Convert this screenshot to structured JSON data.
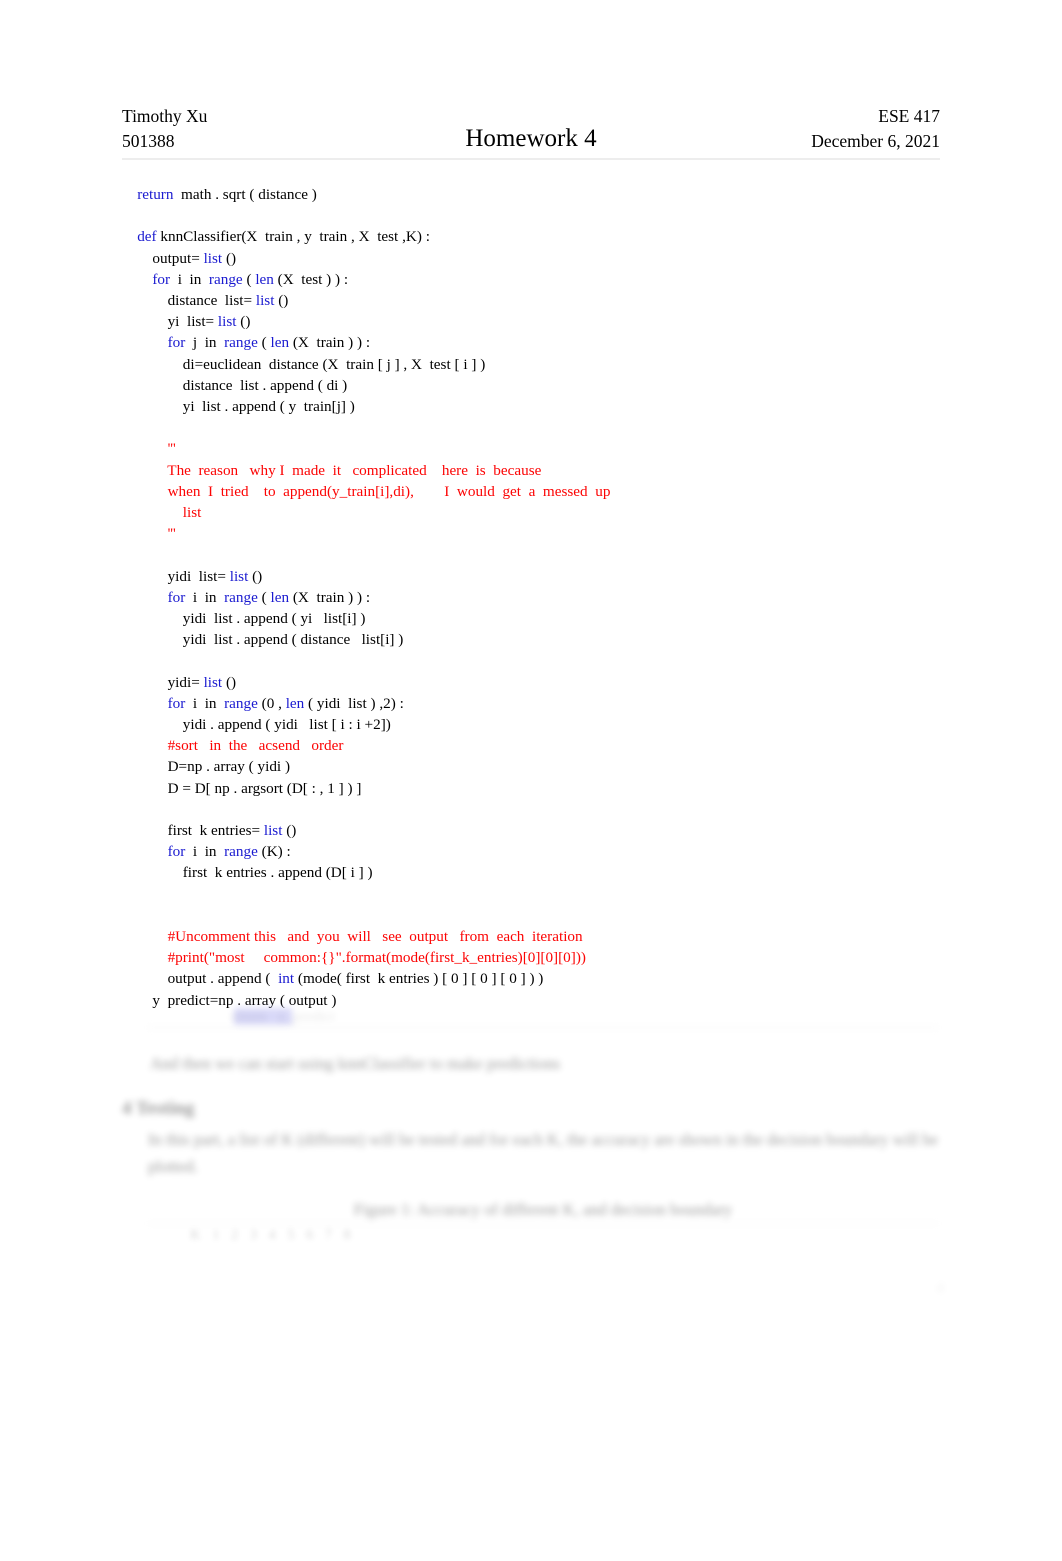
{
  "header": {
    "author": "Timothy Xu",
    "student_id": "501388",
    "title": "Homework  4",
    "course": "ESE 417",
    "date": "December 6, 2021"
  },
  "code": {
    "language": "python",
    "colors": {
      "keyword": "#1a1ad0",
      "comment": "#fc0404",
      "text": "#000000"
    },
    "lines": [
      {
        "indent": 1,
        "segments": [
          {
            "t": "kw",
            "v": "return"
          },
          {
            "t": "plain",
            "v": "  math . sqrt ( distance )"
          }
        ]
      },
      {
        "indent": 0,
        "segments": []
      },
      {
        "indent": 1,
        "segments": [
          {
            "t": "kw",
            "v": "def"
          },
          {
            "t": "plain",
            "v": " knnClassifier(X  train , y  train , X  test ,K) :"
          }
        ]
      },
      {
        "indent": 2,
        "segments": [
          {
            "t": "plain",
            "v": "output= "
          },
          {
            "t": "kw",
            "v": "list"
          },
          {
            "t": "plain",
            "v": " ()"
          }
        ]
      },
      {
        "indent": 2,
        "segments": [
          {
            "t": "kw",
            "v": "for"
          },
          {
            "t": "plain",
            "v": "  i  in  "
          },
          {
            "t": "kw",
            "v": "range"
          },
          {
            "t": "plain",
            "v": " ( "
          },
          {
            "t": "kw",
            "v": "len"
          },
          {
            "t": "plain",
            "v": " (X  test ) ) :"
          }
        ]
      },
      {
        "indent": 3,
        "segments": [
          {
            "t": "plain",
            "v": "distance  list= "
          },
          {
            "t": "kw",
            "v": "list"
          },
          {
            "t": "plain",
            "v": " ()"
          }
        ]
      },
      {
        "indent": 3,
        "segments": [
          {
            "t": "plain",
            "v": "yi  list= "
          },
          {
            "t": "kw",
            "v": "list"
          },
          {
            "t": "plain",
            "v": " ()"
          }
        ]
      },
      {
        "indent": 3,
        "segments": [
          {
            "t": "kw",
            "v": "for"
          },
          {
            "t": "plain",
            "v": "  j  in  "
          },
          {
            "t": "kw",
            "v": "range"
          },
          {
            "t": "plain",
            "v": " ( "
          },
          {
            "t": "kw",
            "v": "len"
          },
          {
            "t": "plain",
            "v": " (X  train ) ) :"
          }
        ]
      },
      {
        "indent": 4,
        "segments": [
          {
            "t": "plain",
            "v": "di=euclidean  distance (X  train [ j ] , X  test [ i ] )"
          }
        ]
      },
      {
        "indent": 4,
        "segments": [
          {
            "t": "plain",
            "v": "distance  list . append ( di )"
          }
        ]
      },
      {
        "indent": 4,
        "segments": [
          {
            "t": "plain",
            "v": "yi  list . append ( y  train[j] )"
          }
        ]
      },
      {
        "indent": 0,
        "segments": []
      },
      {
        "indent": 3,
        "segments": [
          {
            "t": "cm",
            "v": "'''"
          }
        ]
      },
      {
        "indent": 3,
        "segments": [
          {
            "t": "cm",
            "v": "The  reason   why I  made  it   complicated    here  is  because"
          }
        ]
      },
      {
        "indent": 3,
        "segments": [
          {
            "t": "cm",
            "v": "when  I  tried    to  append(y_train[i],di),        I  would  get  a  messed  up"
          }
        ]
      },
      {
        "indent": 4,
        "segments": [
          {
            "t": "cm",
            "v": "list"
          }
        ]
      },
      {
        "indent": 3,
        "segments": [
          {
            "t": "cm",
            "v": "'''"
          }
        ]
      },
      {
        "indent": 0,
        "segments": []
      },
      {
        "indent": 3,
        "segments": [
          {
            "t": "plain",
            "v": "yidi  list= "
          },
          {
            "t": "kw",
            "v": "list"
          },
          {
            "t": "plain",
            "v": " ()"
          }
        ]
      },
      {
        "indent": 3,
        "segments": [
          {
            "t": "kw",
            "v": "for"
          },
          {
            "t": "plain",
            "v": "  i  in  "
          },
          {
            "t": "kw",
            "v": "range"
          },
          {
            "t": "plain",
            "v": " ( "
          },
          {
            "t": "kw",
            "v": "len"
          },
          {
            "t": "plain",
            "v": " (X  train ) ) :"
          }
        ]
      },
      {
        "indent": 4,
        "segments": [
          {
            "t": "plain",
            "v": "yidi  list . append ( yi   list[i] )"
          }
        ]
      },
      {
        "indent": 4,
        "segments": [
          {
            "t": "plain",
            "v": "yidi  list . append ( distance   list[i] )"
          }
        ]
      },
      {
        "indent": 0,
        "segments": []
      },
      {
        "indent": 3,
        "segments": [
          {
            "t": "plain",
            "v": "yidi= "
          },
          {
            "t": "kw",
            "v": "list"
          },
          {
            "t": "plain",
            "v": " ()"
          }
        ]
      },
      {
        "indent": 3,
        "segments": [
          {
            "t": "kw",
            "v": "for"
          },
          {
            "t": "plain",
            "v": "  i  in  "
          },
          {
            "t": "kw",
            "v": "range"
          },
          {
            "t": "plain",
            "v": " (0 , "
          },
          {
            "t": "kw",
            "v": "len"
          },
          {
            "t": "plain",
            "v": " ( yidi  list ) ,2) :"
          }
        ]
      },
      {
        "indent": 4,
        "segments": [
          {
            "t": "plain",
            "v": "yidi . append ( yidi   list [ i : i +2])"
          }
        ]
      },
      {
        "indent": 3,
        "segments": [
          {
            "t": "cm",
            "v": "#sort   in  the   acsend   order"
          }
        ]
      },
      {
        "indent": 3,
        "segments": [
          {
            "t": "plain",
            "v": "D=np . array ( yidi )"
          }
        ]
      },
      {
        "indent": 3,
        "segments": [
          {
            "t": "plain",
            "v": "D = D[ np . argsort (D[ : , 1 ] ) ]"
          }
        ]
      },
      {
        "indent": 0,
        "segments": []
      },
      {
        "indent": 3,
        "segments": [
          {
            "t": "plain",
            "v": "first  k entries= "
          },
          {
            "t": "kw",
            "v": "list"
          },
          {
            "t": "plain",
            "v": " ()"
          }
        ]
      },
      {
        "indent": 3,
        "segments": [
          {
            "t": "kw",
            "v": "for"
          },
          {
            "t": "plain",
            "v": "  i  in  "
          },
          {
            "t": "kw",
            "v": "range"
          },
          {
            "t": "plain",
            "v": " (K) :"
          }
        ]
      },
      {
        "indent": 4,
        "segments": [
          {
            "t": "plain",
            "v": "first  k entries . append (D[ i ] )"
          }
        ]
      },
      {
        "indent": 0,
        "segments": []
      },
      {
        "indent": 0,
        "segments": []
      },
      {
        "indent": 3,
        "segments": [
          {
            "t": "cm",
            "v": "#Uncomment this   and  you  will   see  output   from  each  iteration"
          }
        ]
      },
      {
        "indent": 3,
        "segments": [
          {
            "t": "cm",
            "v": "#print(\"most     common:{}\".format(mode(first_k_entries)[0][0][0]))"
          }
        ]
      },
      {
        "indent": 3,
        "segments": [
          {
            "t": "plain",
            "v": "output . append (  "
          },
          {
            "t": "kw",
            "v": "int"
          },
          {
            "t": "plain",
            "v": " (mode( first  k entries ) [ 0 ] [ 0 ] [ 0 ] ) )"
          }
        ]
      },
      {
        "indent": 2,
        "segments": [
          {
            "t": "plain",
            "v": "y  predict=np . array ( output )"
          }
        ]
      }
    ]
  },
  "faded_tail": {
    "note": "content below the code block is heavily blurred/faded in the screenshot and is not legible",
    "partial_code_line": "y  predict=np . array ( output )",
    "obscured_line": "return   y_predict",
    "obscured_paragraph": "And then we can start using knnClassifier to make predictions",
    "obscured_heading": "4   Testing",
    "obscured_body": "In this part, a list of K (different) will be tested and for each K, the accuracy are shown in the decision boundary will be plotted.",
    "obscured_caption": "Figure 1: Accuracy of different K, and decision boundary",
    "obscured_tablerow": "K   1   2   3   4   5   6   7   8",
    "page_number": "4"
  }
}
